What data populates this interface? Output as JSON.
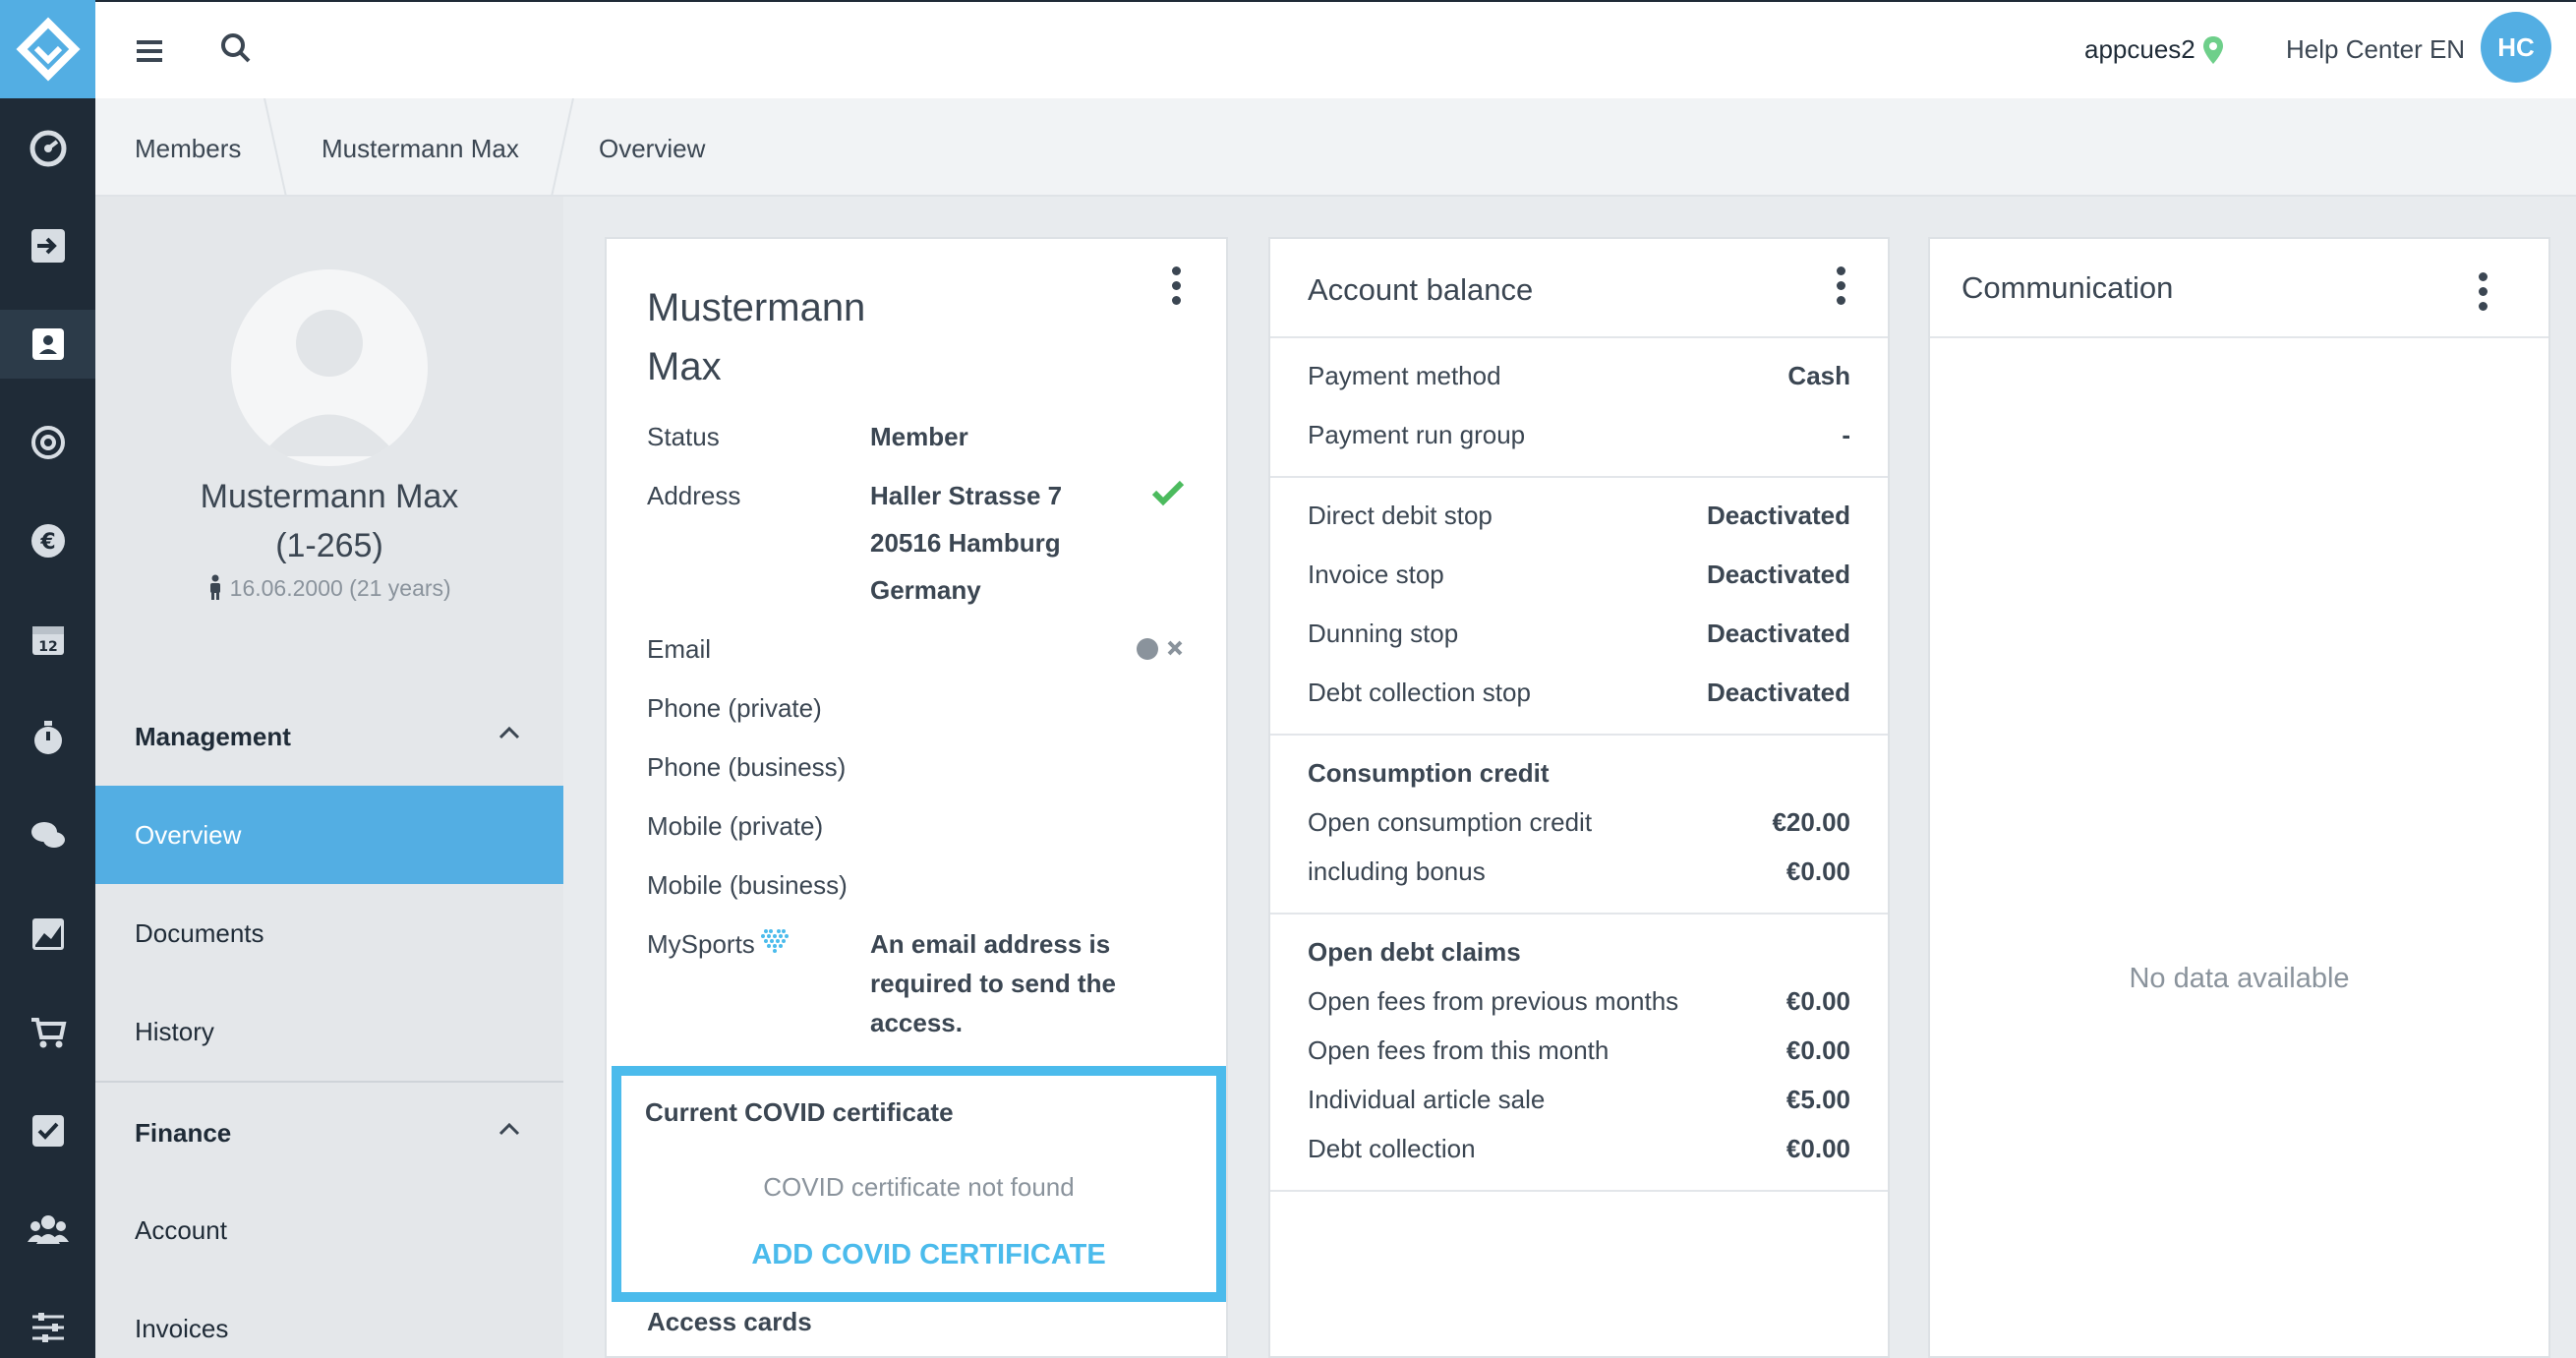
{
  "topbar": {
    "user": "appcues2",
    "help": "Help Center EN",
    "avatar": "HC"
  },
  "breadcrumb": [
    "Members",
    "Mustermann Max",
    "Overview"
  ],
  "profile": {
    "name": "Mustermann Max",
    "id": "(1-265)",
    "dob": "16.06.2000 (21 years)"
  },
  "sidebar": {
    "management": "Management",
    "items": [
      "Overview",
      "Documents",
      "History"
    ],
    "finance": "Finance",
    "finance_items": [
      "Account",
      "Invoices"
    ]
  },
  "member_card": {
    "last_name": "Mustermann",
    "first_name": "Max",
    "status_label": "Status",
    "status_value": "Member",
    "address_label": "Address",
    "address_1": "Haller Strasse 7",
    "address_2": "20516 Hamburg",
    "address_3": "Germany",
    "email_label": "Email",
    "phone_private": "Phone (private)",
    "phone_business": "Phone (business)",
    "mobile_private": "Mobile (private)",
    "mobile_business": "Mobile (business)",
    "mysports_label": "MySports",
    "mysports_1": "An email address is",
    "mysports_2": "required to send the",
    "mysports_3": "access.",
    "covid_title": "Current COVID certificate",
    "covid_empty": "COVID certificate not found",
    "covid_add": "ADD COVID CERTIFICATE",
    "access_cards": "Access cards"
  },
  "balance_card": {
    "title": "Account balance",
    "payment_method_label": "Payment method",
    "payment_method_value": "Cash",
    "payment_run_label": "Payment run group",
    "payment_run_value": "-",
    "direct_debit_label": "Direct debit stop",
    "direct_debit_value": "Deactivated",
    "invoice_stop_label": "Invoice stop",
    "invoice_stop_value": "Deactivated",
    "dunning_label": "Dunning stop",
    "dunning_value": "Deactivated",
    "debt_stop_label": "Debt collection stop",
    "debt_stop_value": "Deactivated",
    "consumption_title": "Consumption credit",
    "open_consumption_label": "Open consumption credit",
    "open_consumption_value": "€20.00",
    "bonus_label": "including bonus",
    "bonus_value": "€0.00",
    "debt_title": "Open debt claims",
    "prev_months_label": "Open fees from previous months",
    "prev_months_value": "€0.00",
    "this_month_label": "Open fees from this month",
    "this_month_value": "€0.00",
    "article_label": "Individual article sale",
    "article_value": "€5.00",
    "debt_collection_label": "Debt collection",
    "debt_collection_value": "€0.00"
  },
  "communication_card": {
    "title": "Communication",
    "empty": "No data available"
  },
  "colors": {
    "accent": "#53aee3",
    "rail": "#1f2b37",
    "success": "#4cbb5e",
    "covid_border": "#4bbbec"
  }
}
